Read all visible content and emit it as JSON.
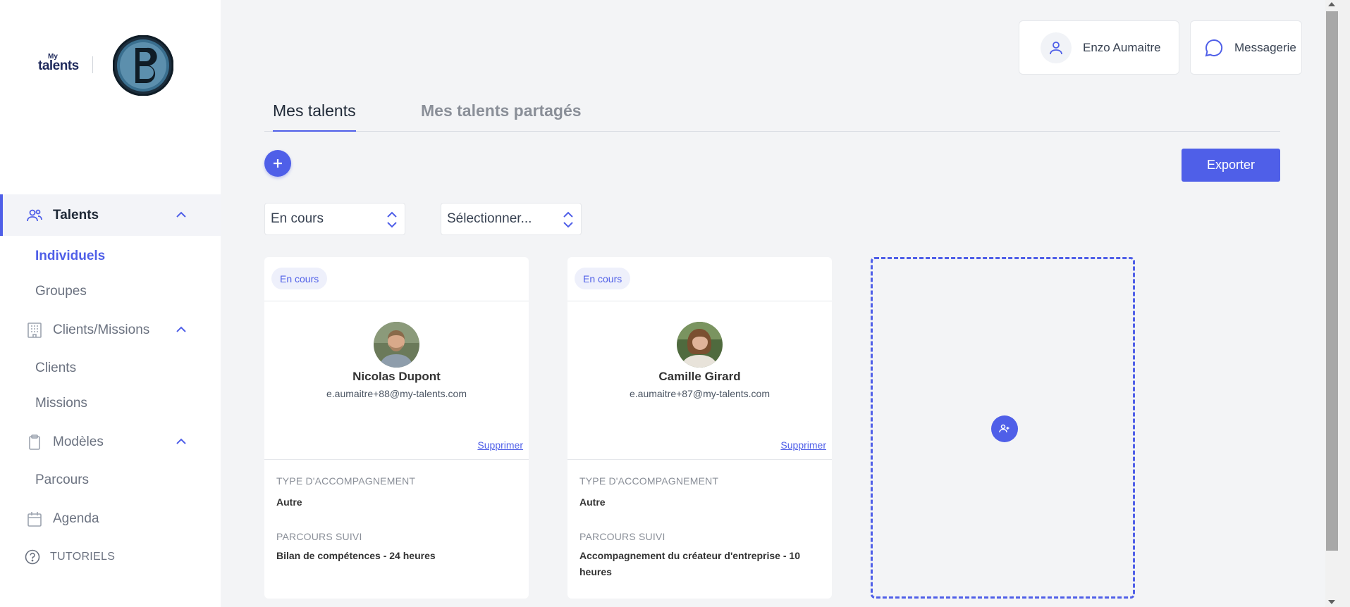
{
  "brand": {
    "logo_small": "My",
    "logo_big": "talents",
    "partner_logo": "B-logo"
  },
  "sidebar": {
    "items": [
      {
        "label": "Talents",
        "icon": "users-icon",
        "active": true
      },
      {
        "label": "Individuels",
        "sub": true,
        "active": true
      },
      {
        "label": "Groupes",
        "sub": true
      },
      {
        "label": "Clients/Missions",
        "icon": "building-icon"
      },
      {
        "label": "Clients",
        "sub": true
      },
      {
        "label": "Missions",
        "sub": true
      },
      {
        "label": "Modèles",
        "icon": "clipboard-icon"
      },
      {
        "label": "Parcours",
        "sub": true
      },
      {
        "label": "Agenda",
        "icon": "calendar-icon"
      },
      {
        "label": "TUTORIELS",
        "icon": "help-circle-icon"
      }
    ]
  },
  "header": {
    "user_name": "Enzo Aumaitre",
    "messages_label": "Messagerie"
  },
  "tabs": {
    "active": "Mes talents",
    "inactive": "Mes talents partagés"
  },
  "toolbar": {
    "export_label": "Exporter"
  },
  "filters": {
    "status_value": "En cours",
    "second_placeholder": "Sélectionner..."
  },
  "cards": [
    {
      "status": "En cours",
      "name": "Nicolas Dupont",
      "email": "e.aumaitre+88@my-talents.com",
      "delete_label": "Supprimer",
      "type_label": "TYPE D'ACCOMPAGNEMENT",
      "type_value": "Autre",
      "path_label": "PARCOURS SUIVI",
      "path_value": "Bilan de compétences - 24 heures"
    },
    {
      "status": "En cours",
      "name": "Camille Girard",
      "email": "e.aumaitre+87@my-talents.com",
      "delete_label": "Supprimer",
      "type_label": "TYPE D'ACCOMPAGNEMENT",
      "type_value": "Autre",
      "path_label": "PARCOURS SUIVI",
      "path_value": "Accompagnement du créateur d'entreprise - 10 heures"
    }
  ],
  "colors": {
    "accent": "#4f5fe8",
    "background": "#f3f4f6"
  }
}
